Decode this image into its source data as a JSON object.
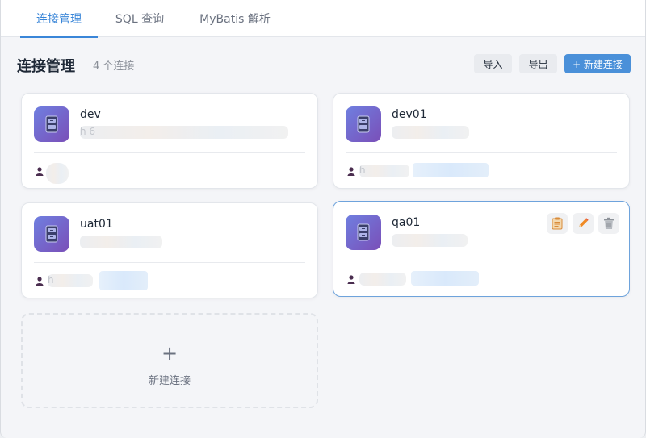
{
  "tabs": [
    {
      "label": "连接管理",
      "active": true
    },
    {
      "label": "SQL 查询",
      "active": false
    },
    {
      "label": "MyBatis 解析",
      "active": false
    }
  ],
  "header": {
    "title": "连接管理",
    "count": "4 个连接",
    "import_label": "导入",
    "export_label": "导出",
    "new_label": "+ 新建连接"
  },
  "connections": [
    {
      "name": "dev",
      "host": "h                                                6",
      "icon": "database-icon",
      "user": "",
      "selected": false
    },
    {
      "name": "dev01",
      "host": "",
      "icon": "database-icon",
      "user": "h",
      "selected": false
    },
    {
      "name": "uat01",
      "host": "",
      "icon": "database-icon",
      "user": "h",
      "selected": false
    },
    {
      "name": "qa01",
      "host": "",
      "icon": "database-icon",
      "user": "",
      "selected": true
    }
  ],
  "card_actions": [
    {
      "icon": "clipboard-icon"
    },
    {
      "icon": "pencil-icon"
    },
    {
      "icon": "trash-icon"
    }
  ],
  "add_card": {
    "plus": "+",
    "label": "新建连接"
  },
  "colors": {
    "accent": "#3a86d8",
    "primary_button": "#4a90d9",
    "icon_gradient_start": "#6f7fe0",
    "icon_gradient_end": "#7a4fb8",
    "selected_border": "#6ea3dc"
  }
}
